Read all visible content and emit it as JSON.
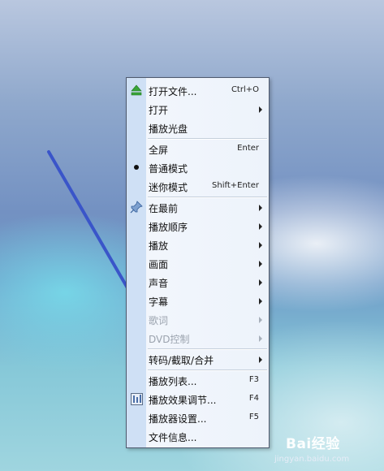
{
  "menu": {
    "items": [
      {
        "label": "打开文件...",
        "shortcut": "Ctrl+O",
        "icon": "eject-icon"
      },
      {
        "label": "打开",
        "submenu": true
      },
      {
        "label": "播放光盘"
      },
      {
        "label": "全屏",
        "shortcut": "Enter"
      },
      {
        "label": "普通模式",
        "icon": "radio-dot-icon",
        "selected": true
      },
      {
        "label": "迷你模式",
        "shortcut": "Shift+Enter"
      },
      {
        "label": "在最前",
        "submenu": true,
        "icon": "pin-icon"
      },
      {
        "label": "播放顺序",
        "submenu": true
      },
      {
        "label": "播放",
        "submenu": true
      },
      {
        "label": "画面",
        "submenu": true
      },
      {
        "label": "声音",
        "submenu": true
      },
      {
        "label": "字幕",
        "submenu": true
      },
      {
        "label": "歌词",
        "submenu": true,
        "disabled": true
      },
      {
        "label": "DVD控制",
        "submenu": true,
        "disabled": true
      },
      {
        "label": "转码/截取/合并",
        "submenu": true
      },
      {
        "label": "播放列表...",
        "shortcut": "F3"
      },
      {
        "label": "播放效果调节...",
        "shortcut": "F4",
        "icon": "effects-icon"
      },
      {
        "label": "播放器设置...",
        "shortcut": "F5"
      },
      {
        "label": "文件信息..."
      }
    ]
  },
  "watermark": {
    "logo": "Bai经验",
    "sub": "jingyan.baidu.com"
  },
  "colors": {
    "menu_bg": "#edf3fb",
    "menu_border": "#4f5a6e",
    "icon_strip": "#cfe0f5",
    "arrow": "#3a55c9",
    "disabled": "#9ba3ae"
  }
}
